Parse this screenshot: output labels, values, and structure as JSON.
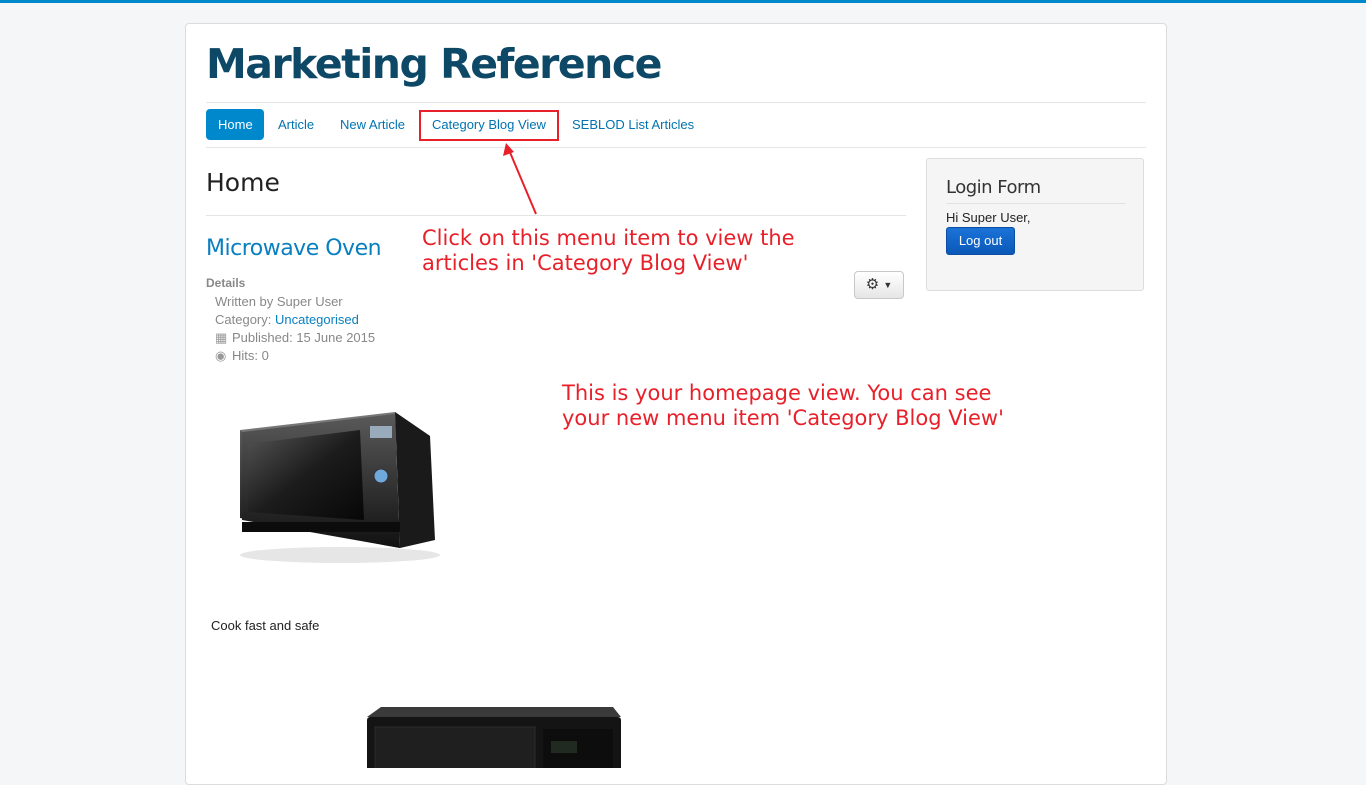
{
  "site": {
    "title": "Marketing Reference"
  },
  "nav": {
    "items": [
      {
        "label": "Home",
        "active": true
      },
      {
        "label": "Article"
      },
      {
        "label": "New Article"
      },
      {
        "label": "Category Blog View"
      },
      {
        "label": "SEBLOD List Articles"
      }
    ]
  },
  "page": {
    "heading": "Home"
  },
  "article": {
    "title": "Microwave Oven",
    "details_label": "Details",
    "written_by": "Written by Super User",
    "category_prefix": "Category: ",
    "category": "Uncategorised",
    "published": "Published: 15 June 2015",
    "hits": "Hits: 0",
    "body": "Cook fast and safe"
  },
  "sidebar": {
    "title": "Login Form",
    "greeting": "Hi Super User,",
    "logout_label": "Log out"
  },
  "annotations": {
    "menu_line1": "Click on this menu item to view the",
    "menu_line2": "articles in 'Category Blog View'",
    "home_line1": "This is your homepage view. You can see",
    "home_line2": "your new menu item 'Category Blog View'"
  },
  "colors": {
    "accent": "#0088cc",
    "title": "#0d4866",
    "link": "#0a7fc0",
    "annotation": "#e8202a",
    "logout": "#0a59b8"
  },
  "icons": [
    "gear-icon",
    "calendar-icon",
    "eye-icon",
    "caret-down-icon"
  ]
}
